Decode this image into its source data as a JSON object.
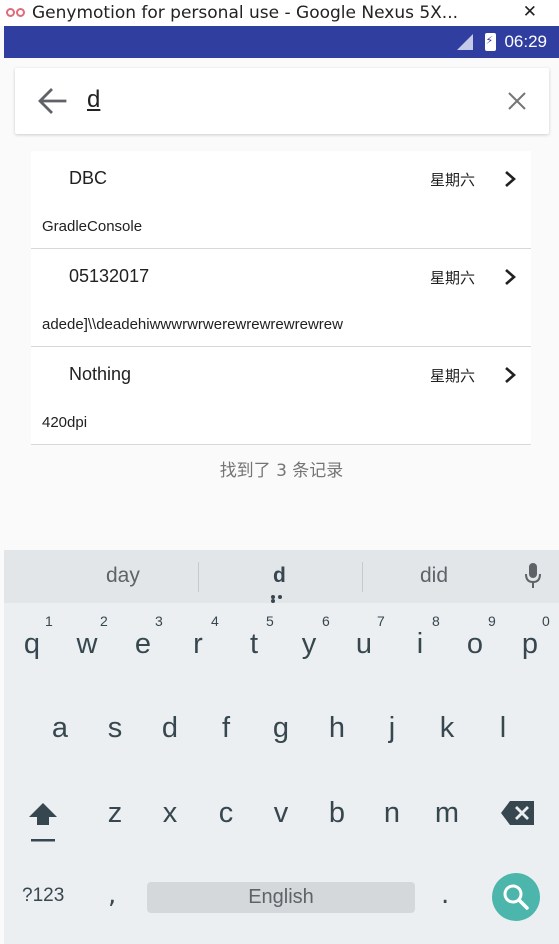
{
  "window": {
    "title": "Genymotion for personal use - Google Nexus 5X..."
  },
  "statusbar": {
    "time": "06:29"
  },
  "search": {
    "query": "d"
  },
  "results": [
    {
      "title": "DBC",
      "day": "星期六",
      "content": "GradleConsole"
    },
    {
      "title": "05132017",
      "day": "星期六",
      "content": "adede]\\\\deadehiwwwrwrwerewrewrewrewrew"
    },
    {
      "title": "Nothing",
      "day": "星期六",
      "content": "420dpi"
    }
  ],
  "found_text": "找到了 3 条记录",
  "keyboard": {
    "suggestions": [
      "day",
      "d",
      "did"
    ],
    "row1": [
      "q",
      "w",
      "e",
      "r",
      "t",
      "y",
      "u",
      "i",
      "o",
      "p"
    ],
    "row1_hints": [
      "1",
      "2",
      "3",
      "4",
      "5",
      "6",
      "7",
      "8",
      "9",
      "0"
    ],
    "row2": [
      "a",
      "s",
      "d",
      "f",
      "g",
      "h",
      "j",
      "k",
      "l"
    ],
    "row3": [
      "z",
      "x",
      "c",
      "v",
      "b",
      "n",
      "m"
    ],
    "symbols_label": "?123",
    "comma": ",",
    "space_label": "English",
    "period": ".",
    "accent_color": "#4db6ac"
  }
}
